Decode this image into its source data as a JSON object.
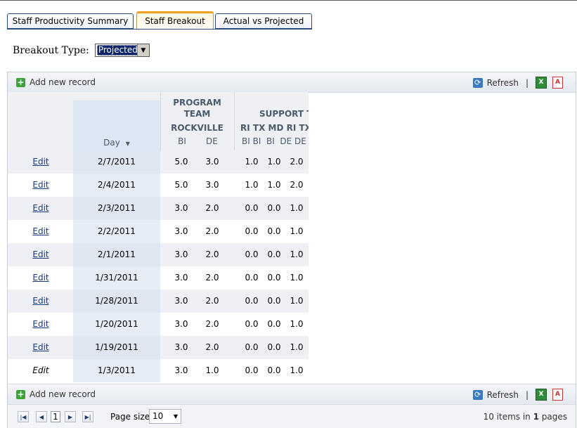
{
  "tabs": [
    {
      "label": "Staff Productivity Summary"
    },
    {
      "label": "Staff Breakout"
    },
    {
      "label": "Actual vs Projected"
    }
  ],
  "breakout": {
    "label": "Breakout Type:",
    "selected": "Projected"
  },
  "toolbar": {
    "add_label": "Add new record",
    "refresh_label": "Refresh",
    "separator": "|"
  },
  "headers": {
    "program_team": [
      "PROGRAM",
      "TEAM",
      "ROCKVILLE"
    ],
    "support_team": "SUPPORT TE",
    "support_states": "RI TX MD RI TX M",
    "day": "Day",
    "pt_sub": [
      "BI",
      "DE"
    ],
    "st_sub": "BI BI  BI  DE DE"
  },
  "rows": [
    {
      "edit": "Edit",
      "day": "2/7/2011",
      "v1": "5.0",
      "v2": "3.0",
      "v3": "1.0",
      "v4": "1.0",
      "v5": "2.0"
    },
    {
      "edit": "Edit",
      "day": "2/4/2011",
      "v1": "5.0",
      "v2": "3.0",
      "v3": "1.0",
      "v4": "1.0",
      "v5": "2.0"
    },
    {
      "edit": "Edit",
      "day": "2/3/2011",
      "v1": "3.0",
      "v2": "2.0",
      "v3": "0.0",
      "v4": "0.0",
      "v5": "1.0"
    },
    {
      "edit": "Edit",
      "day": "2/2/2011",
      "v1": "3.0",
      "v2": "2.0",
      "v3": "0.0",
      "v4": "0.0",
      "v5": "1.0"
    },
    {
      "edit": "Edit",
      "day": "2/1/2011",
      "v1": "3.0",
      "v2": "2.0",
      "v3": "0.0",
      "v4": "0.0",
      "v5": "1.0"
    },
    {
      "edit": "Edit",
      "day": "1/31/2011",
      "v1": "3.0",
      "v2": "2.0",
      "v3": "0.0",
      "v4": "0.0",
      "v5": "1.0"
    },
    {
      "edit": "Edit",
      "day": "1/28/2011",
      "v1": "3.0",
      "v2": "2.0",
      "v3": "0.0",
      "v4": "0.0",
      "v5": "1.0"
    },
    {
      "edit": "Edit",
      "day": "1/20/2011",
      "v1": "3.0",
      "v2": "2.0",
      "v3": "0.0",
      "v4": "0.0",
      "v5": "1.0"
    },
    {
      "edit": "Edit",
      "day": "1/19/2011",
      "v1": "3.0",
      "v2": "2.0",
      "v3": "0.0",
      "v4": "0.0",
      "v5": "1.0"
    },
    {
      "edit": "Edit",
      "day": "1/3/2011",
      "v1": "3.0",
      "v2": "1.0",
      "v3": "0.0",
      "v4": "0.0",
      "v5": "1.0"
    }
  ],
  "pager": {
    "current_page": "1",
    "page_size_label": "Page size:",
    "page_size": "10",
    "info_prefix": "10 items in ",
    "info_pages": "1",
    "info_suffix": " pages"
  }
}
